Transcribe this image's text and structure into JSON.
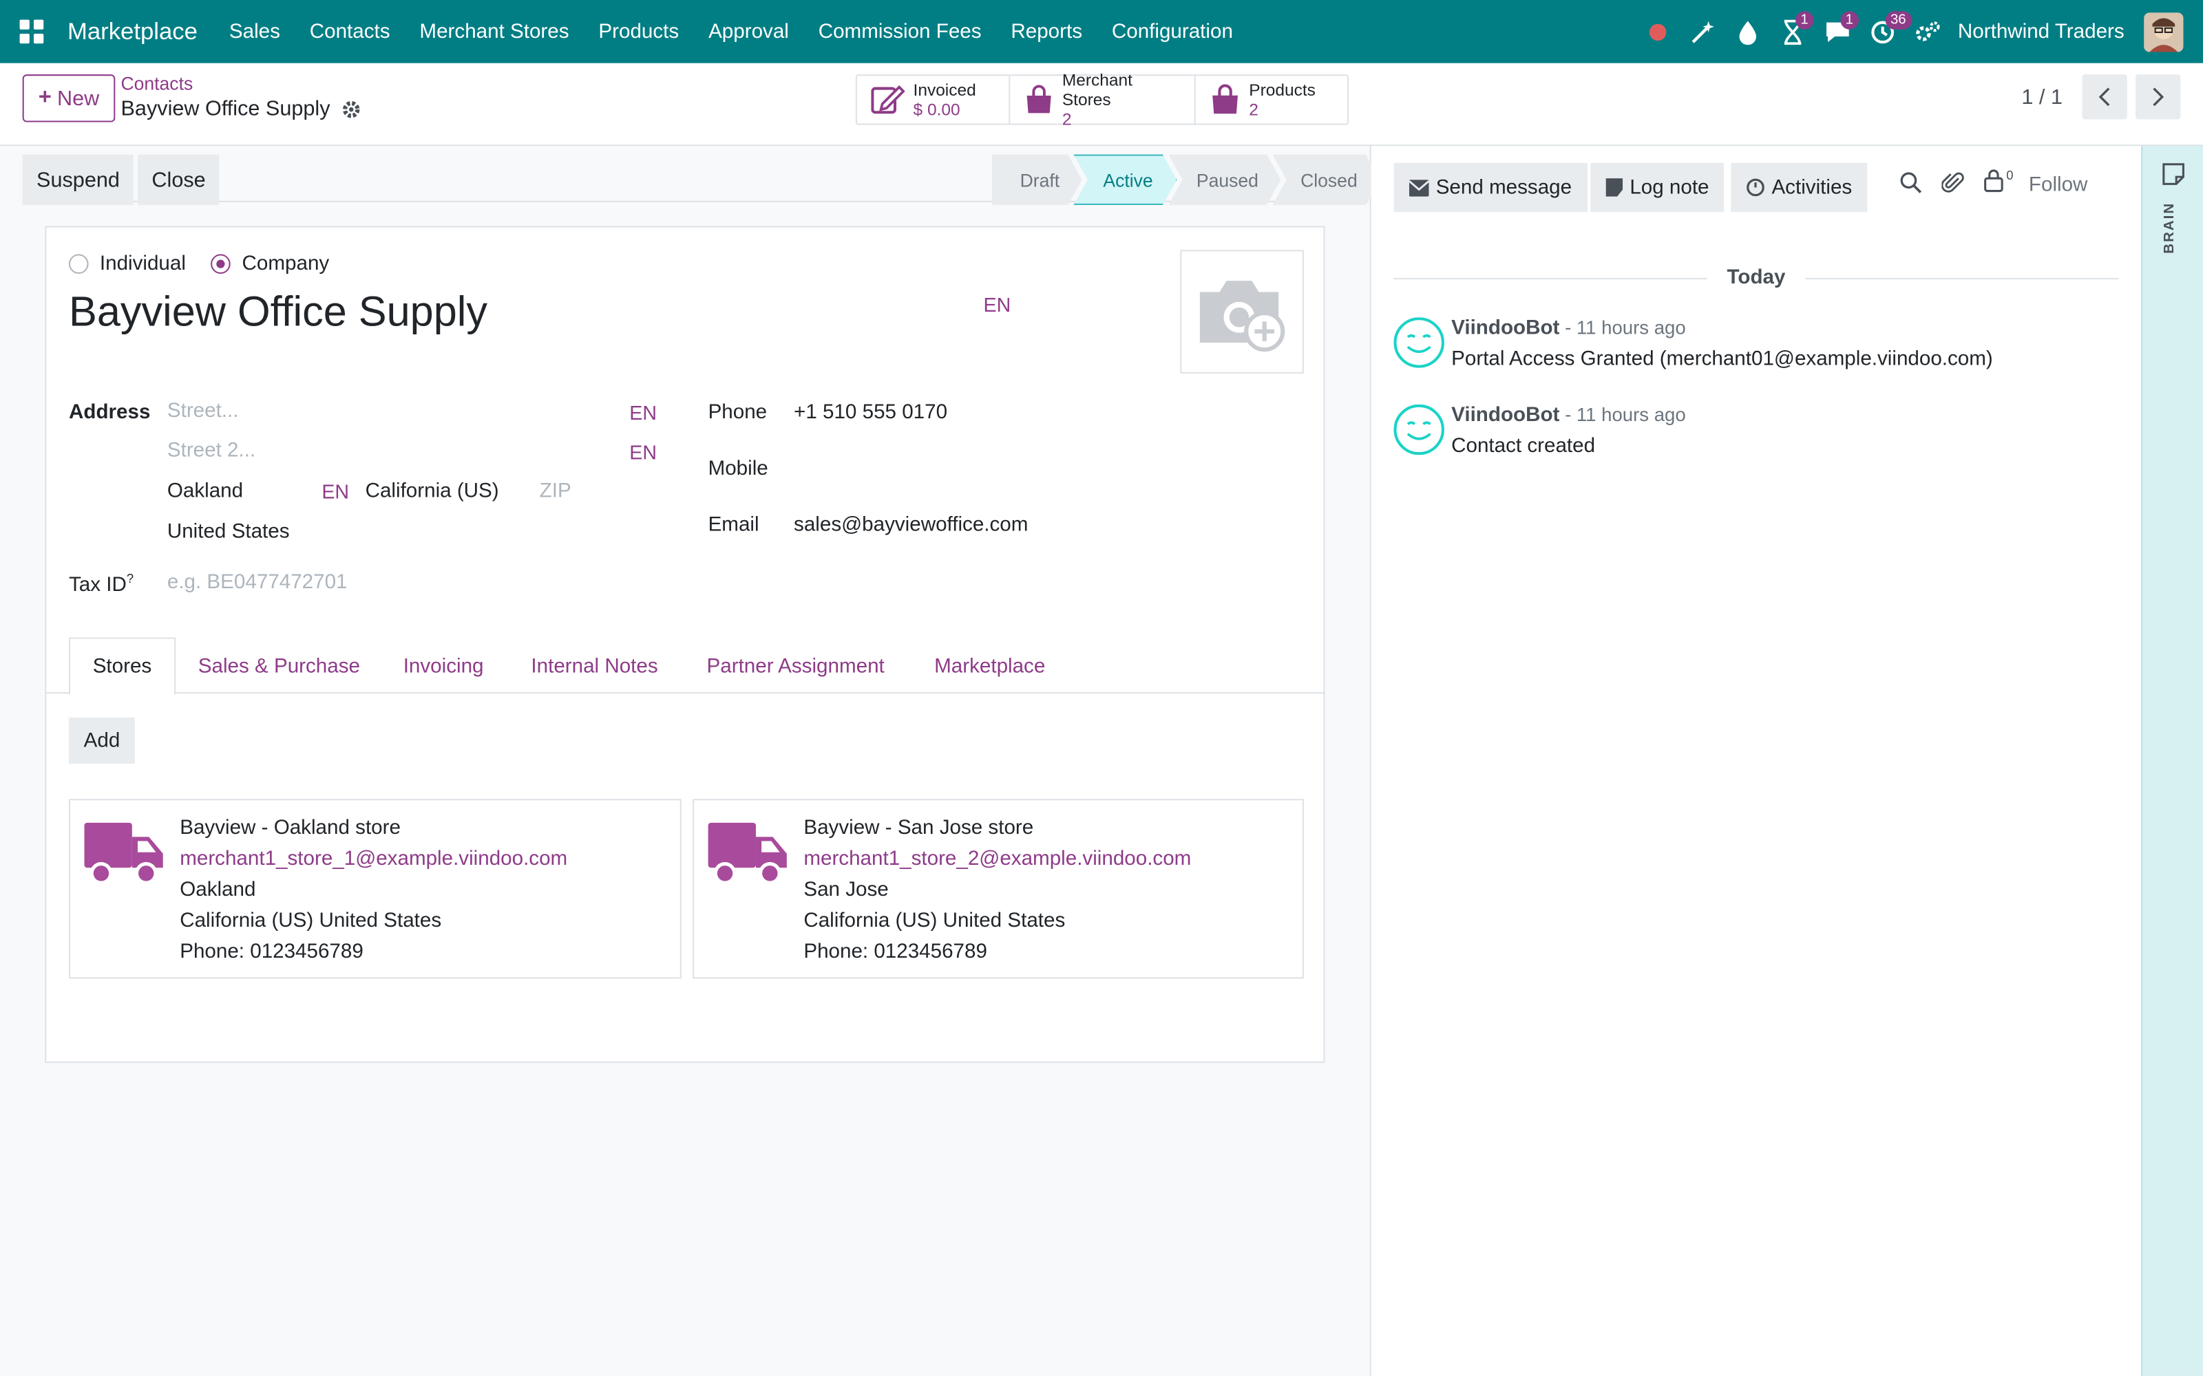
{
  "navbar": {
    "brand": "Marketplace",
    "menu": [
      "Sales",
      "Contacts",
      "Merchant Stores",
      "Products",
      "Approval",
      "Commission Fees",
      "Reports",
      "Configuration"
    ],
    "badges": {
      "activities": "1",
      "messages": "1",
      "clock": "36"
    },
    "company": "Northwind Traders",
    "accent": "#017e84"
  },
  "control": {
    "new_label": "New",
    "breadcrumb_parent": "Contacts",
    "breadcrumb_current": "Bayview Office Supply",
    "smart_buttons": [
      {
        "label": "Invoiced",
        "value": "$ 0.00"
      },
      {
        "label": "Merchant Stores",
        "value": "2"
      },
      {
        "label": "Products",
        "value": "2"
      }
    ],
    "pager": "1 / 1"
  },
  "statusbar": {
    "suspend": "Suspend",
    "close": "Close",
    "stages": [
      "Draft",
      "Active",
      "Paused",
      "Closed"
    ],
    "current_stage": "Active"
  },
  "form": {
    "type_individual": "Individual",
    "type_company": "Company",
    "name": "Bayview Office Supply",
    "lang_tag": "EN",
    "address_label": "Address",
    "street_placeholder": "Street...",
    "street2_placeholder": "Street 2...",
    "city": "Oakland",
    "state": "California (US)",
    "zip_placeholder": "ZIP",
    "country": "United States",
    "tax_label": "Tax ID",
    "tax_sup": "?",
    "tax_placeholder": "e.g. BE0477472701",
    "phone_label": "Phone",
    "phone": "+1 510 555 0170",
    "mobile_label": "Mobile",
    "email_label": "Email",
    "email": "sales@bayviewoffice.com"
  },
  "tabs": [
    "Stores",
    "Sales & Purchase",
    "Invoicing",
    "Internal Notes",
    "Partner Assignment",
    "Marketplace"
  ],
  "stores": {
    "add_label": "Add",
    "cards": [
      {
        "name": "Bayview - Oakland store",
        "email": "merchant1_store_1@example.viindoo.com",
        "city": "Oakland",
        "region": "California (US) United States",
        "phone": "Phone: 0123456789"
      },
      {
        "name": "Bayview - San Jose store",
        "email": "merchant1_store_2@example.viindoo.com",
        "city": "San Jose",
        "region": "California (US) United States",
        "phone": "Phone: 0123456789"
      }
    ]
  },
  "chatter": {
    "send_message": "Send message",
    "log_note": "Log note",
    "activities": "Activities",
    "followers_count": "0",
    "follow": "Follow",
    "today": "Today",
    "messages": [
      {
        "author": "ViindooBot",
        "ago": " - 11 hours ago",
        "body": "Portal Access Granted (merchant01@example.viindoo.com)"
      },
      {
        "author": "ViindooBot",
        "ago": " - 11 hours ago",
        "body": "Contact created"
      }
    ]
  },
  "brain_label": "BRAIN",
  "colors": {
    "primary": "#8e3b88",
    "teal": "#017e84"
  }
}
